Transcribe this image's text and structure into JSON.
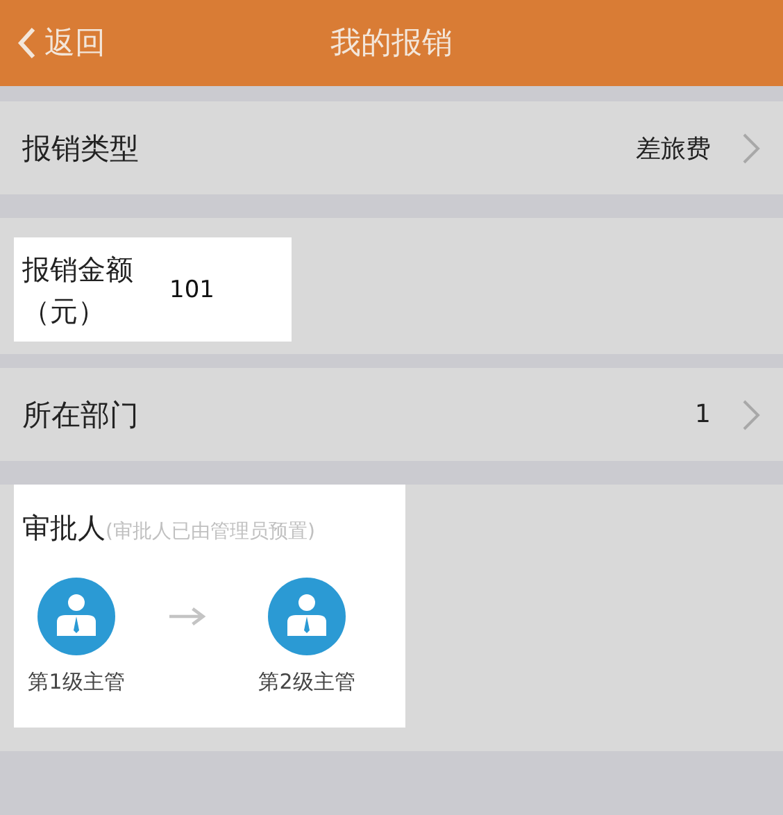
{
  "header": {
    "back": "返回",
    "title": "我的报销"
  },
  "type_row": {
    "label": "报销类型",
    "value": "差旅费"
  },
  "amount": {
    "label_line1": "报销金额",
    "label_line2": "（元）",
    "value": "101"
  },
  "department_row": {
    "label": "所在部门",
    "value": "1"
  },
  "approvers": {
    "title": "审批人",
    "note": "(审批人已由管理员预置)",
    "steps": [
      {
        "label": "第1级主管"
      },
      {
        "label": "第2级主管"
      }
    ]
  }
}
